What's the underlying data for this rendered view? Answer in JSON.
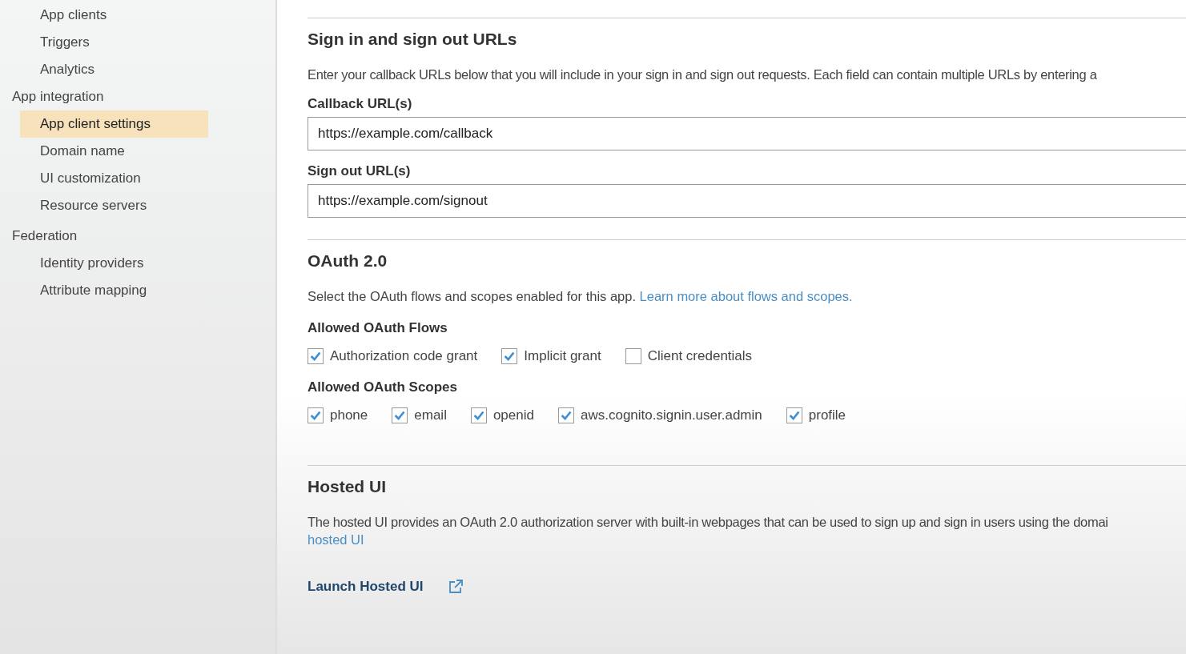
{
  "sidebar": {
    "groups": [
      {
        "children": [
          {
            "label": "App clients",
            "selected": false
          },
          {
            "label": "Triggers",
            "selected": false
          },
          {
            "label": "Analytics",
            "selected": false
          }
        ]
      },
      {
        "label": "App integration",
        "children": [
          {
            "label": "App client settings",
            "selected": true
          },
          {
            "label": "Domain name",
            "selected": false
          },
          {
            "label": "UI customization",
            "selected": false
          },
          {
            "label": "Resource servers",
            "selected": false
          }
        ]
      },
      {
        "label": "Federation",
        "children": [
          {
            "label": "Identity providers",
            "selected": false
          },
          {
            "label": "Attribute mapping",
            "selected": false
          }
        ]
      }
    ]
  },
  "sign_in_out": {
    "title": "Sign in and sign out URLs",
    "description": "Enter your callback URLs below that you will include in your sign in and sign out requests. Each field can contain multiple URLs by entering a",
    "fields": [
      {
        "label": "Callback URL(s)",
        "value": "https://example.com/callback"
      },
      {
        "label": "Sign out URL(s)",
        "value": "https://example.com/signout"
      }
    ]
  },
  "oauth": {
    "title": "OAuth 2.0",
    "description": "Select the OAuth flows and scopes enabled for this app.",
    "link": "Learn more about flows and scopes.",
    "groups": [
      {
        "label": "Allowed OAuth Flows",
        "options": [
          {
            "label": "Authorization code grant",
            "checked": true
          },
          {
            "label": "Implicit grant",
            "checked": true
          },
          {
            "label": "Client credentials",
            "checked": false
          }
        ]
      },
      {
        "label": "Allowed OAuth Scopes",
        "options": [
          {
            "label": "phone",
            "checked": true
          },
          {
            "label": "email",
            "checked": true
          },
          {
            "label": "openid",
            "checked": true
          },
          {
            "label": "aws.cognito.signin.user.admin",
            "checked": true
          },
          {
            "label": "profile",
            "checked": true
          }
        ]
      }
    ]
  },
  "hosted_ui": {
    "title": "Hosted UI",
    "description": "The hosted UI provides an OAuth 2.0 authorization server with built-in webpages that can be used to sign up and sign in users using the domai",
    "link": "hosted UI",
    "launch": "Launch Hosted UI"
  }
}
